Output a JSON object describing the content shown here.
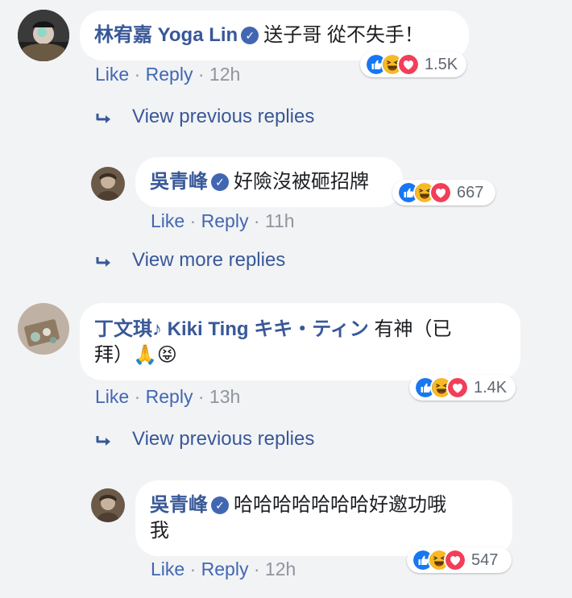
{
  "actions": {
    "like": "Like",
    "reply": "Reply",
    "dot": "·"
  },
  "threads": [
    {
      "comment": {
        "name": "林宥嘉 Yoga Lin",
        "text": "送子哥 從不失手！",
        "time": "12h",
        "reaction_count": "1.5K",
        "reaction_icons": [
          "like-icon",
          "haha-icon",
          "love-icon"
        ]
      },
      "view_link": "View previous replies",
      "reply": {
        "name": "吳青峰",
        "text": "好險沒被砸招牌",
        "time": "11h",
        "reaction_count": "667",
        "reaction_icons": [
          "like-icon",
          "haha-icon",
          "love-icon"
        ]
      },
      "more_link": "View more replies"
    },
    {
      "comment": {
        "name": "丁文琪♪ Kiki Ting キキ・ティン",
        "text_line1": "有神（已",
        "text_line2": "拜）",
        "emoji": [
          "🙏",
          "😝"
        ],
        "time": "13h",
        "reaction_count": "1.4K",
        "reaction_icons": [
          "like-icon",
          "haha-icon",
          "love-icon"
        ]
      },
      "view_link": "View previous replies",
      "reply": {
        "name": "吳青峰",
        "text_line1": "哈哈哈哈哈哈哈好邀功哦",
        "text_line2": "我",
        "time": "12h",
        "reaction_count": "547",
        "reaction_icons": [
          "like-icon",
          "haha-icon",
          "love-icon"
        ]
      }
    }
  ],
  "colors": {
    "background": "#f2f3f5",
    "name_blue": "#385898",
    "action_blue": "#4267b2",
    "meta_gray": "#90949c",
    "like_blue": "#1877f2",
    "haha_yellow": "#f7b928",
    "love_red": "#f33e58"
  }
}
